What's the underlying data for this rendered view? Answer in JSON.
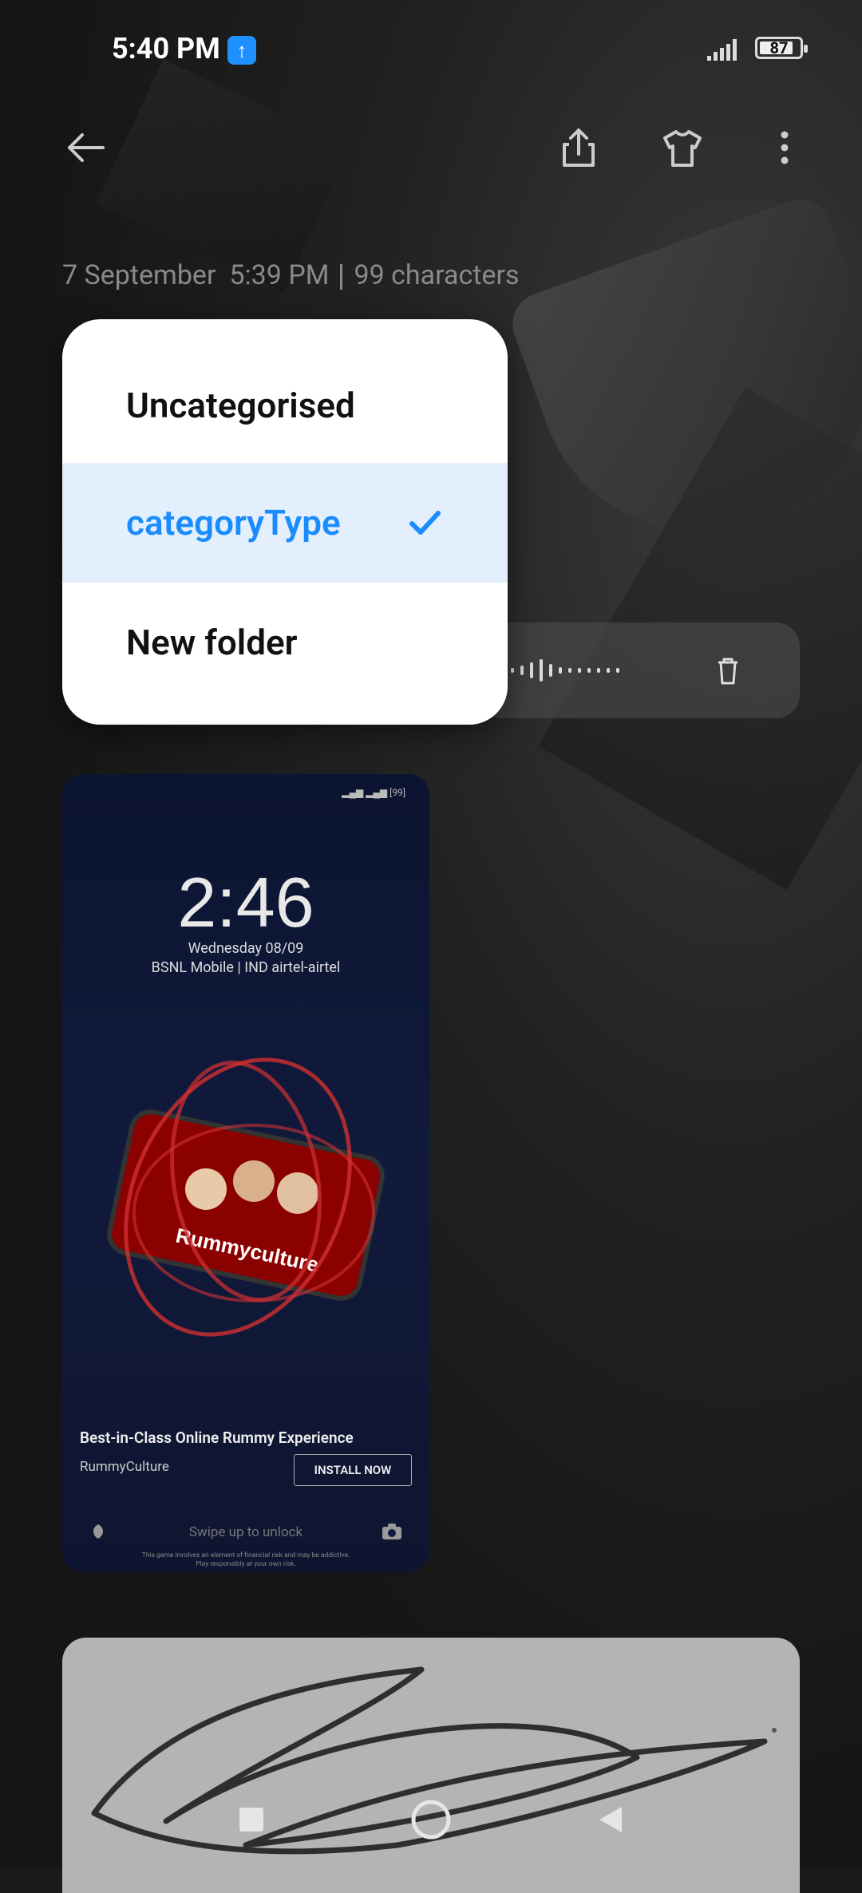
{
  "status_bar": {
    "time": "5:40 PM",
    "battery": "87"
  },
  "note": {
    "date": "7 September",
    "time": "5:39 PM",
    "characters": "99 characters"
  },
  "folder_menu": {
    "items": [
      {
        "label": "Uncategorised",
        "selected": false
      },
      {
        "label": "categoryType",
        "selected": true
      },
      {
        "label": "New folder",
        "selected": false
      }
    ]
  },
  "attachment_screenshot": {
    "lock_time": "2:46",
    "lock_date": "Wednesday 08/09",
    "carrier": "BSNL Mobile | IND airtel-airtel",
    "status_battery": "99",
    "ad_brand_overlay": "Rummyculture",
    "ad_title": "Best-in-Class Online Rummy Experience",
    "ad_brand": "RummyCulture",
    "install_label": "INSTALL NOW",
    "swipe_text": "Swipe up to unlock",
    "disclaimer_line1": "This game involves an element of financial risk and may be addictive.",
    "disclaimer_line2": "Play responsibly at your own risk."
  },
  "colors": {
    "accent": "#1a8cff",
    "selected_bg": "#e3effc",
    "background": "#1a1a1a"
  }
}
